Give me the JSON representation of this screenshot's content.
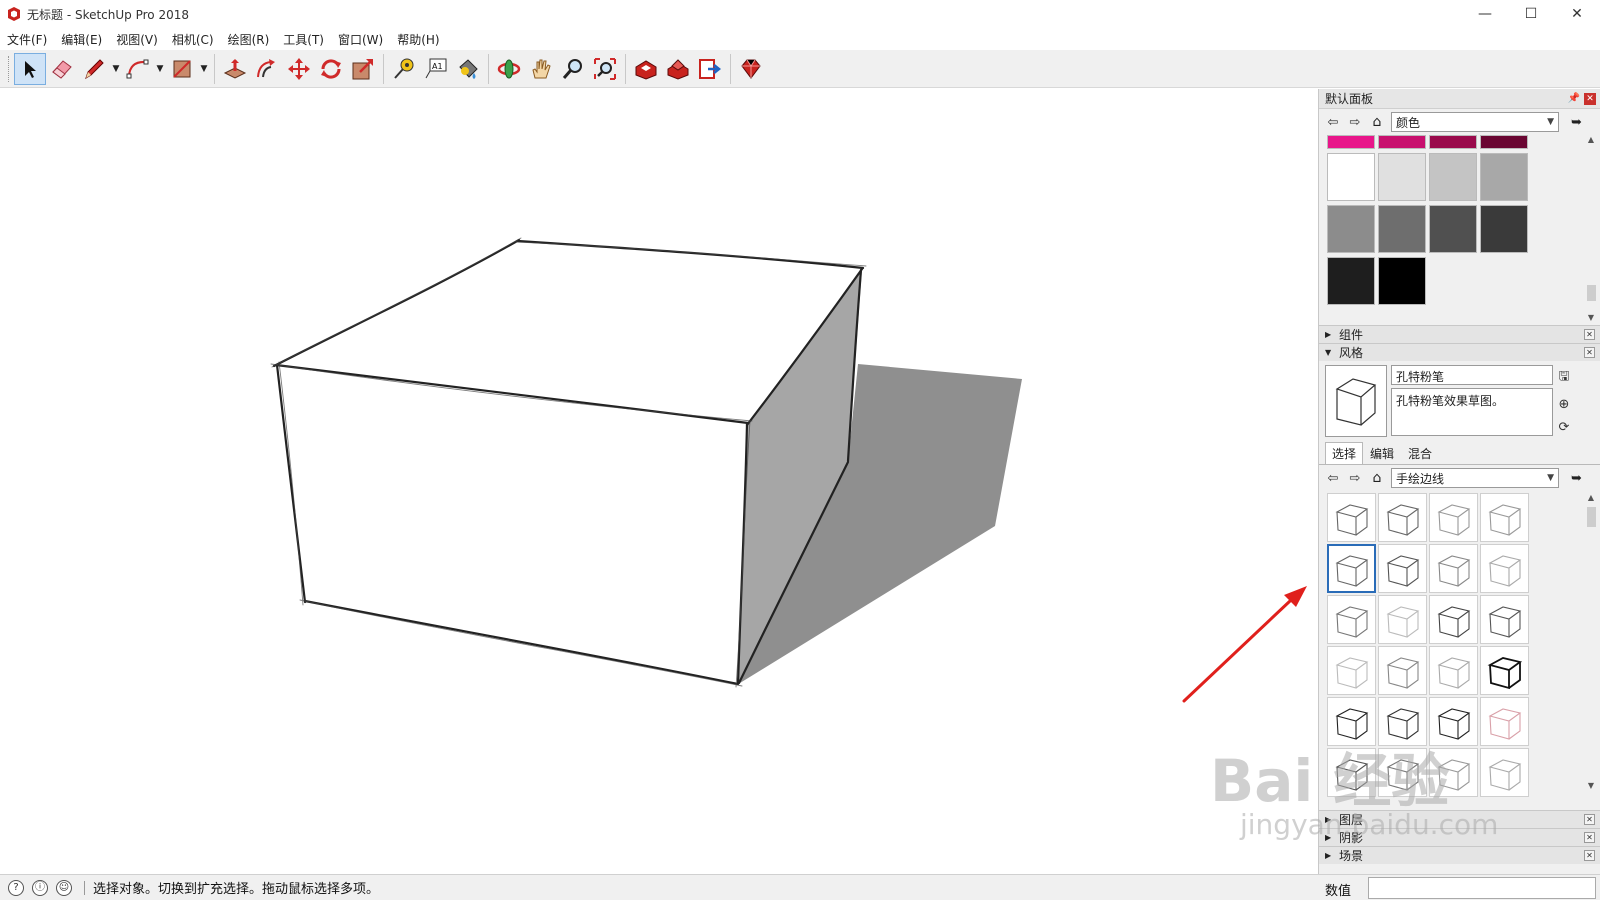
{
  "window": {
    "title": "无标题 - SketchUp Pro 2018",
    "minimize_glyph": "—",
    "maximize_glyph": "☐",
    "close_glyph": "✕"
  },
  "menu": {
    "items": [
      "文件(F)",
      "编辑(E)",
      "视图(V)",
      "相机(C)",
      "绘图(R)",
      "工具(T)",
      "窗口(W)",
      "帮助(H)"
    ]
  },
  "toolbar": {
    "tools": [
      {
        "name": "select",
        "icon": "select-arrow-icon",
        "active": true
      },
      {
        "name": "eraser",
        "icon": "eraser-icon"
      },
      {
        "name": "line",
        "icon": "pencil-icon",
        "dropdown": true
      },
      {
        "name": "arc",
        "icon": "arc-icon",
        "dropdown": true
      },
      {
        "name": "rectangle",
        "icon": "rectangle-icon",
        "dropdown": true
      },
      {
        "name": "push-pull",
        "icon": "push-pull-icon"
      },
      {
        "name": "offset",
        "icon": "offset-icon"
      },
      {
        "name": "move",
        "icon": "move-icon"
      },
      {
        "name": "rotate",
        "icon": "rotate-icon"
      },
      {
        "name": "scale",
        "icon": "scale-icon"
      },
      {
        "name": "tape-measure",
        "icon": "tape-measure-icon"
      },
      {
        "name": "text",
        "icon": "text-icon"
      },
      {
        "name": "paint-bucket",
        "icon": "paint-bucket-icon"
      },
      {
        "name": "orbit",
        "icon": "orbit-icon"
      },
      {
        "name": "pan",
        "icon": "pan-hand-icon"
      },
      {
        "name": "zoom",
        "icon": "zoom-icon"
      },
      {
        "name": "zoom-extents",
        "icon": "zoom-extents-icon"
      },
      {
        "name": "3d-warehouse",
        "icon": "3d-warehouse-icon"
      },
      {
        "name": "extension-warehouse",
        "icon": "extension-warehouse-icon"
      },
      {
        "name": "send-to-layout",
        "icon": "send-to-layout-icon"
      },
      {
        "name": "ruby-console",
        "icon": "ruby-icon"
      }
    ],
    "text_tool_glyph": "A1"
  },
  "tray": {
    "title": "默认面板",
    "pin_glyph": "📌",
    "close_glyph": "✕",
    "materials": {
      "category": "颜色",
      "strip_colors": [
        "#e8168a",
        "#c8106e",
        "#9a0a4c",
        "#6a0632"
      ],
      "swatches": [
        "#ffffff",
        "#e0e0e0",
        "#c4c4c4",
        "#a8a8a8",
        "#8c8c8c",
        "#6e6e6e",
        "#505050",
        "#3a3a3a",
        "#1e1e1e",
        "#000000"
      ]
    },
    "sections": {
      "components": "组件",
      "styles": "风格",
      "layers": "图层",
      "shadows": "阴影",
      "scenes": "场景"
    },
    "style": {
      "name": "孔特粉笔",
      "description": "孔特粉笔效果草图。"
    },
    "style_tabs": [
      "选择",
      "编辑",
      "混合"
    ],
    "style_collection": "手绘边线",
    "selected_style_index": 4
  },
  "statusbar": {
    "hint": "选择对象。切换到扩充选择。拖动鼠标选择多项。",
    "measurements_label": "数值"
  },
  "watermark": {
    "main": "Bai 经验",
    "sub": "jingyan.baidu.com"
  },
  "colors": {
    "box_outline": "#222222",
    "box_side_shade": "#a6a6a6",
    "shadow": "#8f8f8f",
    "arrow": "#e0201c",
    "selection": "#2a6cb8"
  }
}
